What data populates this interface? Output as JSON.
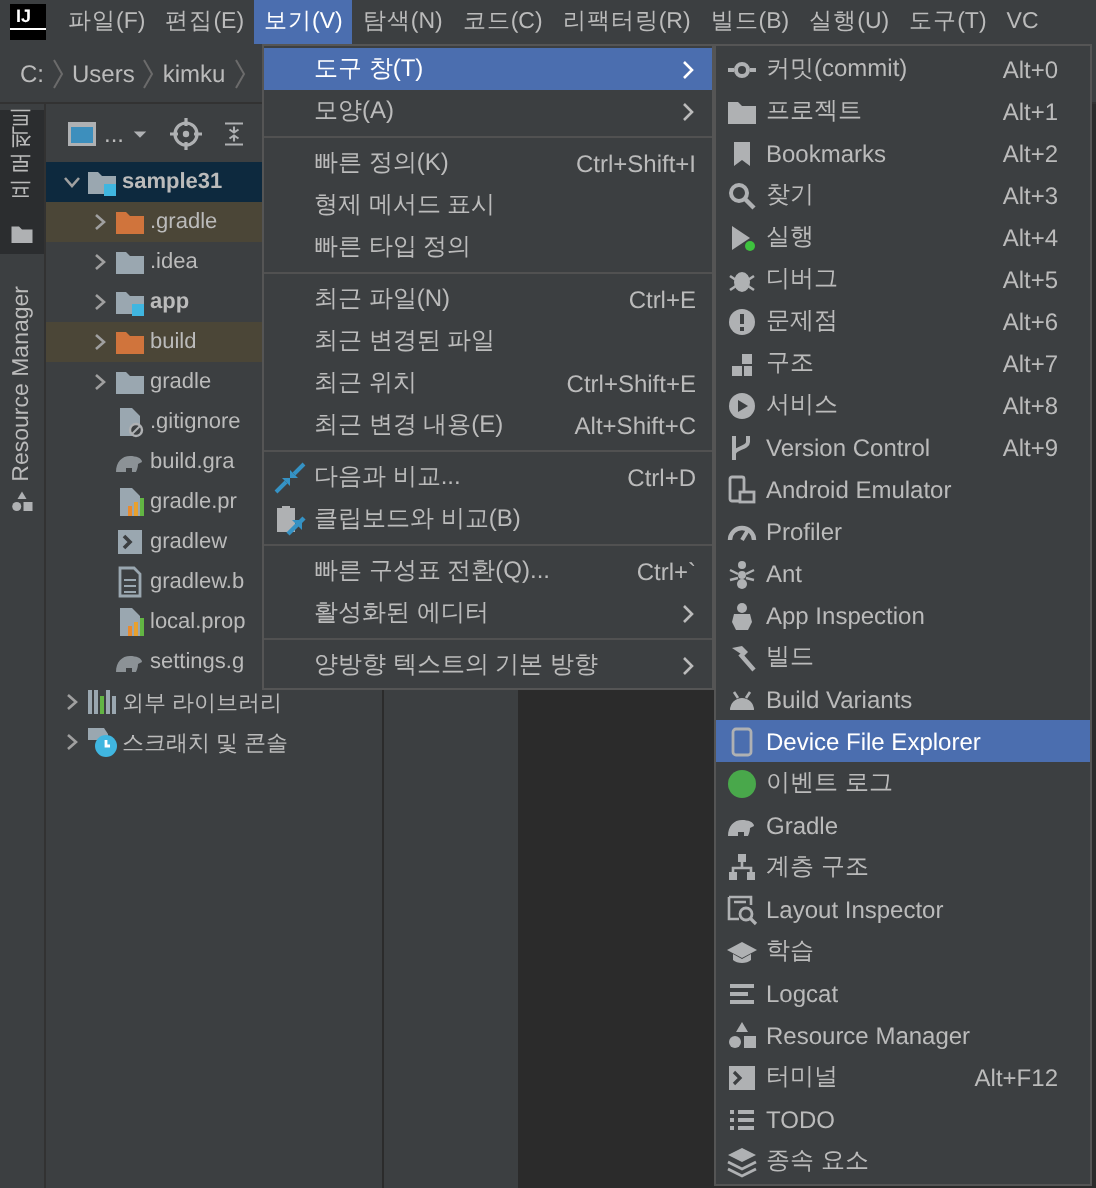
{
  "menu_bar": {
    "logo": "IJ",
    "items": [
      {
        "label": "파일(F)",
        "selected": false
      },
      {
        "label": "편집(E)",
        "selected": false
      },
      {
        "label": "보기(V)",
        "selected": true
      },
      {
        "label": "탐색(N)",
        "selected": false
      },
      {
        "label": "코드(C)",
        "selected": false
      },
      {
        "label": "리팩터링(R)",
        "selected": false
      },
      {
        "label": "빌드(B)",
        "selected": false
      },
      {
        "label": "실행(U)",
        "selected": false
      },
      {
        "label": "도구(T)",
        "selected": false
      },
      {
        "label": "VC",
        "selected": false
      }
    ]
  },
  "breadcrumb": [
    "C:",
    "Users",
    "kimku"
  ],
  "tool_strip": [
    {
      "label": "프로젝트",
      "selected": true
    },
    {
      "label": "Resource Manager",
      "selected": false
    }
  ],
  "project_panel": {
    "view_label": "...",
    "tree": [
      {
        "label": "sample31",
        "kind": "module",
        "selected": true,
        "expanded": true,
        "children": [
          {
            "label": ".gradle",
            "kind": "folder",
            "selected": false,
            "expanded": false,
            "excluded": true
          },
          {
            "label": ".idea",
            "kind": "folder",
            "selected": false,
            "expanded": false,
            "excluded": false
          },
          {
            "label": "app",
            "kind": "module",
            "selected": false,
            "expanded": false,
            "excluded": false
          },
          {
            "label": "build",
            "kind": "folder",
            "selected": false,
            "expanded": false,
            "excluded": true
          },
          {
            "label": "gradle",
            "kind": "folder",
            "selected": false,
            "expanded": false,
            "excluded": false
          },
          {
            "label": ".gitignore",
            "kind": "ignore-file",
            "selected": false
          },
          {
            "label": "build.gra",
            "kind": "gradle-file",
            "selected": false
          },
          {
            "label": "gradle.pr",
            "kind": "properties-file",
            "selected": false
          },
          {
            "label": "gradlew",
            "kind": "script-file",
            "selected": false
          },
          {
            "label": "gradlew.b",
            "kind": "text-file",
            "selected": false
          },
          {
            "label": "local.prop",
            "kind": "properties-file",
            "selected": false
          },
          {
            "label": "settings.g",
            "kind": "gradle-file",
            "selected": false
          }
        ]
      },
      {
        "label": "외부 라이브러리",
        "kind": "libraries",
        "selected": false,
        "expanded": false
      },
      {
        "label": "스크래치 및 콘솔",
        "kind": "scratches",
        "selected": false,
        "expanded": false
      }
    ]
  },
  "view_menu": {
    "sections": [
      {
        "items": [
          {
            "label": "도구 창(T)",
            "submenu": true,
            "selected": true
          },
          {
            "label": "모양(A)",
            "submenu": true,
            "selected": false
          }
        ]
      },
      {
        "items": [
          {
            "label": "빠른 정의(K)",
            "shortcut": "Ctrl+Shift+I",
            "submenu": false,
            "selected": false
          },
          {
            "label": "형제 메서드 표시",
            "submenu": false,
            "selected": false
          },
          {
            "label": "빠른 타입 정의",
            "submenu": false,
            "selected": false
          }
        ]
      },
      {
        "items": [
          {
            "label": "최근 파일(N)",
            "shortcut": "Ctrl+E",
            "submenu": false,
            "selected": false
          },
          {
            "label": "최근 변경된 파일",
            "submenu": false,
            "selected": false
          },
          {
            "label": "최근 위치",
            "shortcut": "Ctrl+Shift+E",
            "submenu": false,
            "selected": false
          },
          {
            "label": "최근 변경 내용(E)",
            "shortcut": "Alt+Shift+C",
            "submenu": false,
            "selected": false
          }
        ]
      },
      {
        "items": [
          {
            "label": "다음과 비교...",
            "shortcut": "Ctrl+D",
            "submenu": false,
            "selected": false
          },
          {
            "label": "클립보드와 비교(B)",
            "submenu": false,
            "selected": false
          }
        ]
      },
      {
        "items": [
          {
            "label": "빠른 구성표 전환(Q)...",
            "shortcut": "Ctrl+`",
            "submenu": false,
            "selected": false
          },
          {
            "label": "활성화된 에디터",
            "submenu": true,
            "selected": false
          }
        ]
      },
      {
        "items": [
          {
            "label": "양방향 텍스트의 기본 방향",
            "submenu": true,
            "selected": false
          }
        ]
      }
    ]
  },
  "tool_windows_menu": {
    "sections": [
      {
        "items": [
          {
            "label": "커밋(commit)",
            "shortcut": "Alt+0",
            "selected": false
          },
          {
            "label": "프로젝트",
            "shortcut": "Alt+1",
            "selected": false
          },
          {
            "label": "Bookmarks",
            "shortcut": "Alt+2",
            "selected": false
          },
          {
            "label": "찾기",
            "shortcut": "Alt+3",
            "selected": false
          },
          {
            "label": "실행",
            "shortcut": "Alt+4",
            "selected": false
          },
          {
            "label": "디버그",
            "shortcut": "Alt+5",
            "selected": false
          },
          {
            "label": "문제점",
            "shortcut": "Alt+6",
            "selected": false
          },
          {
            "label": "구조",
            "shortcut": "Alt+7",
            "selected": false
          },
          {
            "label": "서비스",
            "shortcut": "Alt+8",
            "selected": false
          },
          {
            "label": "Version Control",
            "shortcut": "Alt+9",
            "selected": false
          },
          {
            "label": "Android Emulator",
            "selected": false
          },
          {
            "label": "Profiler",
            "selected": false
          },
          {
            "label": "Ant",
            "selected": false
          },
          {
            "label": "App Inspection",
            "selected": false
          },
          {
            "label": "빌드",
            "selected": false
          },
          {
            "label": "Build Variants",
            "selected": false
          },
          {
            "label": "Device File Explorer",
            "selected": true
          },
          {
            "label": "이벤트 로그",
            "selected": false
          },
          {
            "label": "Gradle",
            "selected": false
          },
          {
            "label": "계층 구조",
            "selected": false
          },
          {
            "label": "Layout Inspector",
            "selected": false
          },
          {
            "label": "학습",
            "selected": false
          },
          {
            "label": "Logcat",
            "selected": false
          },
          {
            "label": "Resource Manager",
            "selected": false
          },
          {
            "label": "터미널",
            "shortcut": "Alt+F12",
            "selected": false
          },
          {
            "label": "TODO",
            "selected": false
          },
          {
            "label": "종속 요소",
            "selected": false
          }
        ]
      }
    ]
  }
}
